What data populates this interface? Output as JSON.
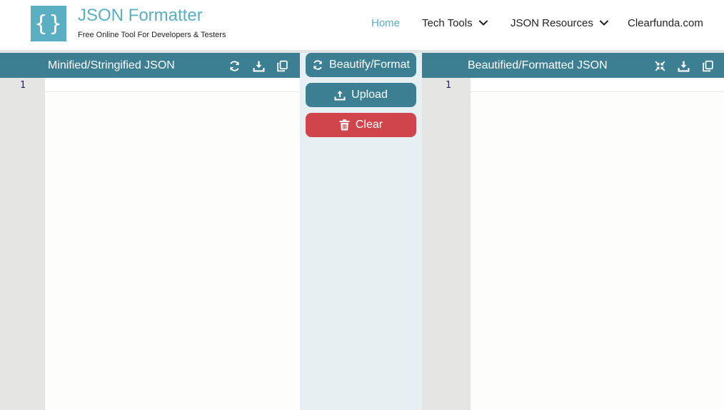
{
  "brand": {
    "logo_text": "{}",
    "title": "JSON Formatter",
    "subtitle": "Free Online Tool For Developers & Testers"
  },
  "nav": {
    "home": "Home",
    "tech_tools": "Tech Tools",
    "json_resources": "JSON Resources",
    "site": "Clearfunda.com"
  },
  "left_panel": {
    "title": "Minified/Stringified JSON",
    "line_numbers": [
      "1"
    ],
    "tools": [
      "refresh-icon",
      "download-icon",
      "copy-icon"
    ]
  },
  "actions": {
    "beautify": "Beautify/Format",
    "upload": "Upload",
    "clear": "Clear"
  },
  "right_panel": {
    "title": "Beautified/Formatted JSON",
    "line_numbers": [
      "1"
    ],
    "tools": [
      "compress-icon",
      "download-icon",
      "copy-icon"
    ]
  },
  "colors": {
    "accent": "#5aafc3",
    "panel_header": "#3d7f92",
    "clear_button": "#d0444b",
    "middle_bg": "#e6f0f3",
    "gutter": "#e5e5e3"
  }
}
